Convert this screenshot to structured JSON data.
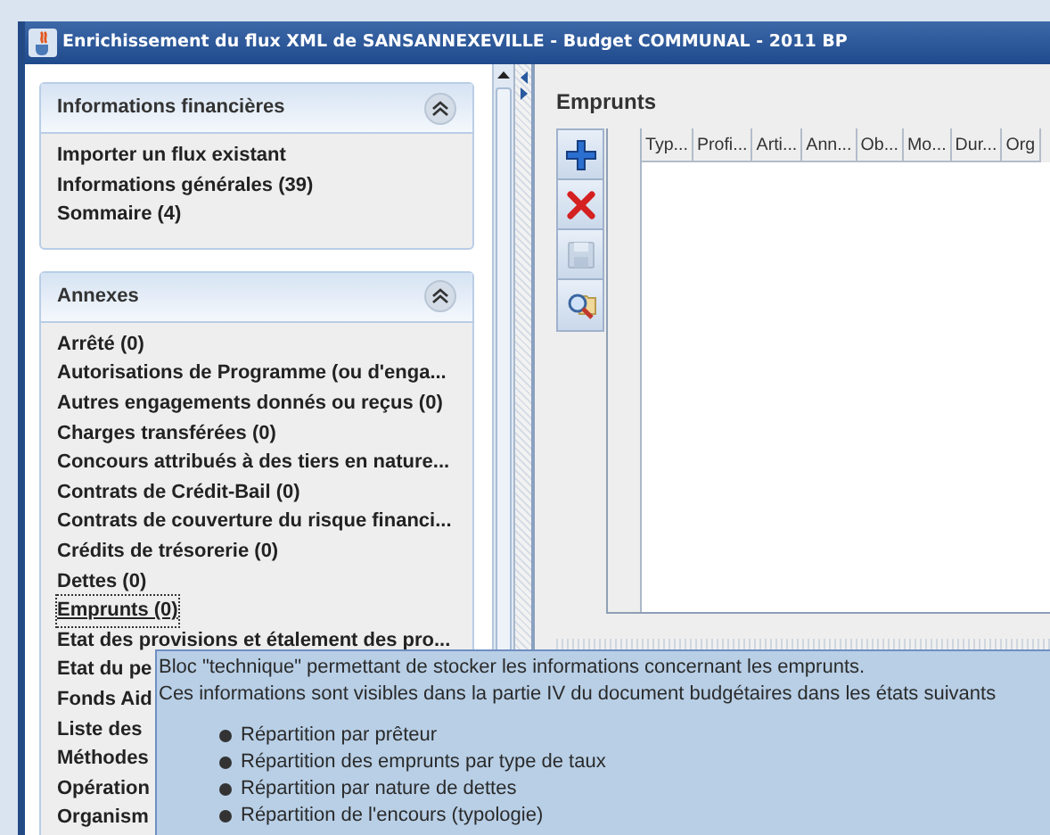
{
  "window": {
    "title": "Enrichissement du flux XML de SANSANNEXEVILLE - Budget COMMUNAL - 2011 BP"
  },
  "sidebar": {
    "sections": [
      {
        "title": "Informations financières",
        "expanded": true,
        "items": [
          {
            "label": "Importer un flux existant",
            "selected": false
          },
          {
            "label": "Informations générales (39)",
            "selected": false
          },
          {
            "label": "Sommaire (4)",
            "selected": false
          }
        ]
      },
      {
        "title": "Annexes",
        "expanded": true,
        "items": [
          {
            "label": "Arrêté (0)",
            "selected": false
          },
          {
            "label": "Autorisations de Programme (ou d'enga...",
            "selected": false
          },
          {
            "label": "Autres engagements donnés ou reçus (0)",
            "selected": false
          },
          {
            "label": "Charges transférées (0)",
            "selected": false
          },
          {
            "label": "Concours attribués à des tiers en nature...",
            "selected": false
          },
          {
            "label": "Contrats de Crédit-Bail (0)",
            "selected": false
          },
          {
            "label": "Contrats de couverture du risque financi...",
            "selected": false
          },
          {
            "label": "Crédits de trésorerie (0)",
            "selected": false
          },
          {
            "label": "Dettes (0)",
            "selected": false
          },
          {
            "label": "Emprunts (0)",
            "selected": true
          },
          {
            "label": "Etat des provisions et étalement des pro...",
            "selected": false
          },
          {
            "label": "Etat du pe",
            "selected": false
          },
          {
            "label": "Fonds Aid",
            "selected": false
          },
          {
            "label": "Liste des",
            "selected": false
          },
          {
            "label": "Méthodes",
            "selected": false
          },
          {
            "label": "Opération",
            "selected": false
          },
          {
            "label": "Organism",
            "selected": false
          }
        ]
      }
    ]
  },
  "panel": {
    "title": "Emprunts",
    "toolbar": [
      {
        "kind": "add",
        "disabled": false
      },
      {
        "kind": "delete",
        "disabled": false
      },
      {
        "kind": "save",
        "disabled": true
      },
      {
        "kind": "search",
        "disabled": false
      }
    ],
    "table": {
      "columns": [
        "Typ...",
        "Profi...",
        "Arti...",
        "Ann...",
        "Ob...",
        "Mo...",
        "Dur...",
        "Org"
      ]
    }
  },
  "tooltip": {
    "lines": [
      "Bloc \"technique\" permettant de stocker les informations concernant les emprunts.",
      "Ces informations sont visibles dans la partie IV du document budgétaires dans les états suivants"
    ],
    "bullets": [
      "Répartition par prêteur",
      "Répartition des emprunts par type de taux",
      "Répartition par nature de dettes",
      "Répartition de l'encours (typologie)"
    ]
  }
}
